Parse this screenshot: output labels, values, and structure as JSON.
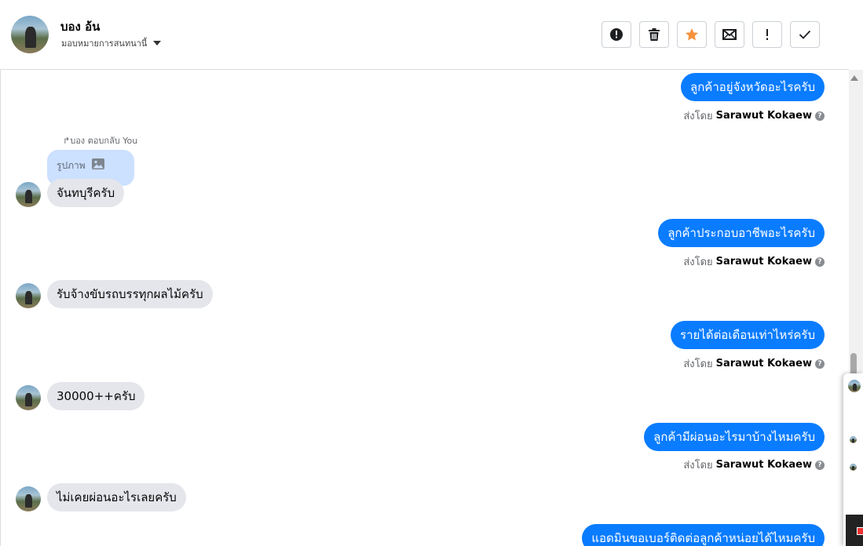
{
  "header": {
    "contact_name": "บอง อ้น",
    "assign_label": "มอบหมายการสนทนานี้",
    "actions": [
      {
        "name": "mark-spam-button",
        "icon": "alert-circle-icon"
      },
      {
        "name": "delete-button",
        "icon": "trash-icon"
      },
      {
        "name": "star-button",
        "icon": "star-icon",
        "color": "#f7923b"
      },
      {
        "name": "mark-unread-button",
        "icon": "envelope-icon"
      },
      {
        "name": "follow-up-button",
        "icon": "exclamation-icon"
      },
      {
        "name": "mark-done-button",
        "icon": "check-icon"
      }
    ]
  },
  "colors": {
    "outgoing_bubble": "#0a7cff",
    "incoming_bubble": "#e4e6eb",
    "reply_quote": "#cce0ff",
    "star": "#f7923b"
  },
  "sent_by": {
    "prefix": "ส่งโดย",
    "name": "Sarawut Kokaew"
  },
  "messages": [
    {
      "direction": "out",
      "text": "ลูกค้าอยู่จังหวัดอะไรครับ"
    },
    {
      "direction": "in",
      "reply_note": "บอง ตอบกลับ You",
      "reply_quote": "รูปภาพ",
      "text": "จันทบุรีครับ"
    },
    {
      "direction": "out",
      "text": "ลูกค้าประกอบอาชีพอะไรครับ"
    },
    {
      "direction": "in",
      "text": "รับจ้างขับรถบรรทุกผลไม้ครับ"
    },
    {
      "direction": "out",
      "text": "รายได้ต่อเดือนเท่าไหร่ครับ"
    },
    {
      "direction": "in",
      "text": "30000++ครับ"
    },
    {
      "direction": "out",
      "text": "ลูกค้ามีผ่อนอะไรมาบ้างไหมครับ"
    },
    {
      "direction": "in",
      "text": "ไม่เคยผ่อนอะไรเลยครับ"
    },
    {
      "direction": "out",
      "text": "แอดมินขอเบอร์ติดต่อลูกค้าหน่อยได้ไหมครับ"
    }
  ]
}
